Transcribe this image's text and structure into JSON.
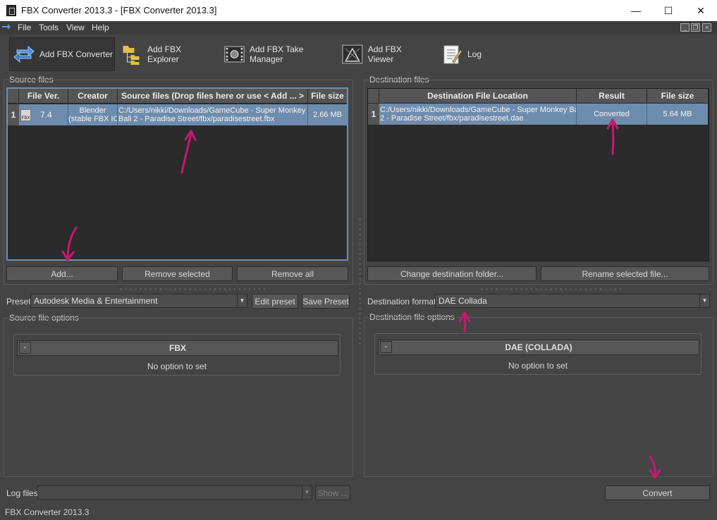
{
  "window": {
    "title": "FBX Converter 2013.3 - [FBX Converter  2013.3]",
    "minimize": "—",
    "maximize": "☐",
    "close": "✕"
  },
  "menu": {
    "file": "File",
    "tools": "Tools",
    "view": "View",
    "help": "Help"
  },
  "toolbar": {
    "add_converter": "Add FBX Converter",
    "add_explorer": "Add FBX Explorer",
    "add_take_manager": "Add FBX Take Manager",
    "add_viewer": "Add FBX Viewer",
    "log": "Log"
  },
  "source": {
    "group_title": "Source files",
    "columns": [
      "File Ver.",
      "Creator",
      "Source files (Drop files here or use < Add ... >",
      "File size"
    ],
    "rows": [
      {
        "num": "1",
        "icon_label": "FBX",
        "file_ver": "7.4",
        "creator_line1": "Blender",
        "creator_line2": "(stable FBX IO",
        "path_line1": "C:/Users/nikki/Downloads/GameCube - Super Monkey",
        "path_line2": "Ball 2 - Paradise Street/fbx/paradisestreet.fbx",
        "size": "2.66 MB"
      }
    ],
    "add": "Add...",
    "remove_selected": "Remove selected",
    "remove_all": "Remove all"
  },
  "destination": {
    "group_title": "Destination files",
    "columns": [
      "Destination File Location",
      "Result",
      "File size"
    ],
    "rows": [
      {
        "num": "1",
        "path_line1": "C:/Users/nikki/Downloads/GameCube - Super Monkey Ball",
        "path_line2": "2 - Paradise Street/fbx/paradisestreet.dae",
        "result": "Converted",
        "size": "5.64 MB"
      }
    ],
    "change_folder": "Change destination folder...",
    "rename_selected": "Rename selected file..."
  },
  "preset": {
    "label": "Preset",
    "value": "Autodesk Media & Entertainment",
    "edit": "Edit preset",
    "save": "Save Preset"
  },
  "dest_format": {
    "label": "Destination format",
    "value": "DAE Collada"
  },
  "source_options": {
    "group_title": "Source file options",
    "section": "FBX",
    "collapse": "-",
    "empty": "No option to set"
  },
  "dest_options": {
    "group_title": "Destination file options",
    "section": "DAE (COLLADA)",
    "collapse": "-",
    "empty": "No option to set"
  },
  "log": {
    "label": "Log files",
    "value": "",
    "show": "Show ..."
  },
  "convert": "Convert",
  "status": "FBX Converter  2013.3",
  "colors": {
    "background": "#444444",
    "selection": "#6e8cad",
    "annotation": "#c8186e"
  }
}
